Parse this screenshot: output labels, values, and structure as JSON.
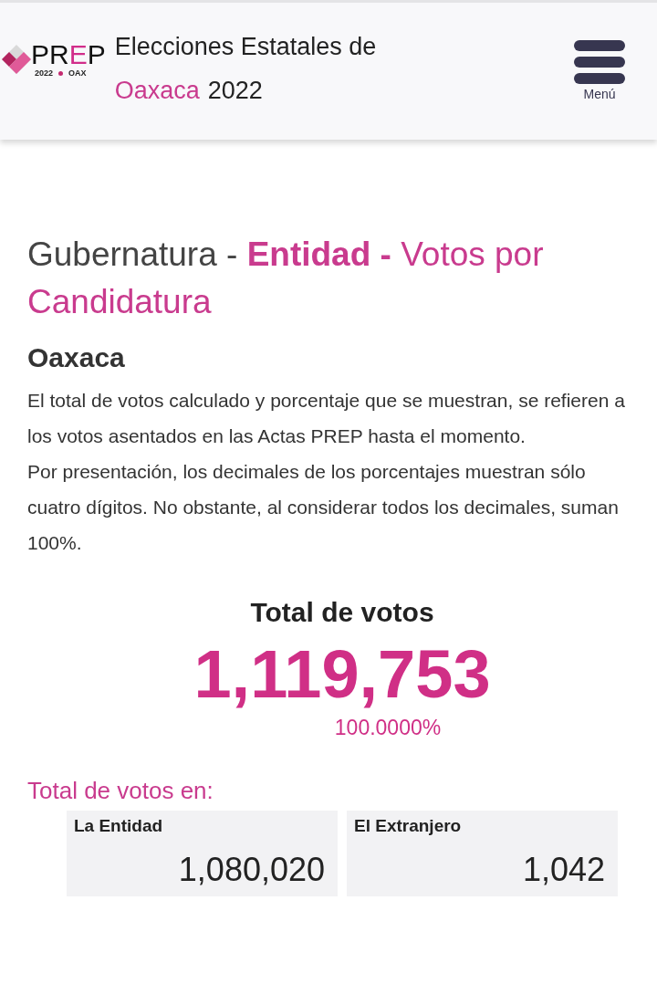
{
  "header": {
    "logo": {
      "prefix": "PR",
      "accent": "E",
      "suffix": "P",
      "year": "2022",
      "state": "OAX"
    },
    "title": {
      "line1": "Elecciones Estatales de",
      "highlight": "Oaxaca",
      "year": "2022"
    },
    "menu_label": "Menú"
  },
  "heading": {
    "part1": "Gubernatura -",
    "part2": "Entidad -",
    "part3": "Votos por Candidatura"
  },
  "subheading": "Oaxaca",
  "notes": [
    "El total de votos calculado y porcentaje que se muestran, se refieren a los votos asentados en las Actas PREP hasta el momento.",
    "Por presentación, los decimales de los porcentajes muestran sólo cuatro dígitos. No obstante, al considerar todos los decimales, suman 100%."
  ],
  "total": {
    "label": "Total de votos",
    "value": "1,119,753",
    "percent": "100.0000%"
  },
  "breakdown": {
    "label": "Total de votos en:",
    "cards": [
      {
        "label": "La Entidad",
        "value": "1,080,020"
      },
      {
        "label": "El Extranjero",
        "value": "1,042"
      }
    ]
  }
}
